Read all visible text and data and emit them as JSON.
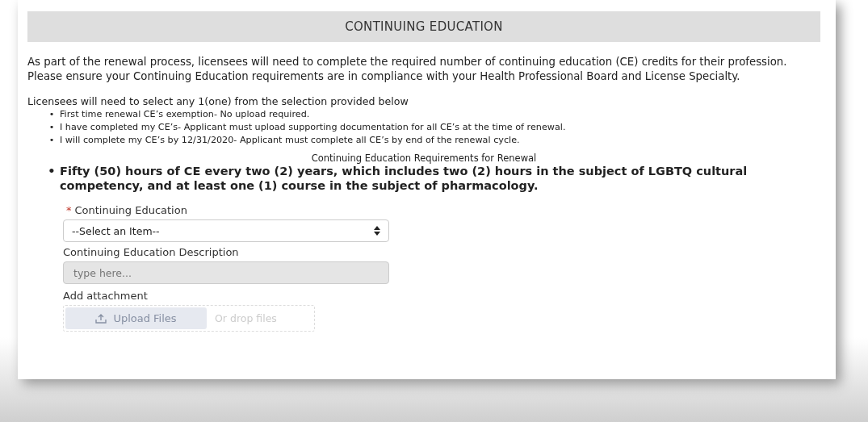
{
  "header": {
    "title": "CONTINUING EDUCATION"
  },
  "intro": "As part of the renewal process, licensees will need to complete the required number of continuing education (CE) credits for their profession. Please ensure your Continuing Education requirements are in compliance with your Health Professional Board and License Specialty.",
  "selection_heading": "Licensees will need to select any 1(one) from the selection provided below",
  "options": [
    {
      "marker": "•",
      "text": "First time renewal CE’s exemption- No upload required."
    },
    {
      "marker": "•",
      "text": "I have completed my CE’s- Applicant must upload supporting documentation for all CE’s at the time of renewal."
    },
    {
      "marker": "•",
      "text": "I will complete my CE’s by 12/31/2020- Applicant must complete all CE’s by end of the renewal cycle."
    }
  ],
  "requirements_heading": "Continuing Education Requirements for Renewal",
  "requirements": [
    {
      "marker": "•",
      "text": "Fifty (50) hours of CE every two (2) years, which includes two (2) hours in the subject of LGBTQ cultural competency, and at least one (1) course in the subject of pharmacology."
    }
  ],
  "form": {
    "select": {
      "label": "Continuing Education",
      "required": true,
      "required_mark": "*",
      "value": "--Select an Item--"
    },
    "description": {
      "label": "Continuing Education Description",
      "placeholder": "type here...",
      "disabled": true
    },
    "attachment": {
      "label": "Add attachment",
      "button": "Upload Files",
      "drop_text": "Or drop files",
      "disabled": true
    }
  }
}
